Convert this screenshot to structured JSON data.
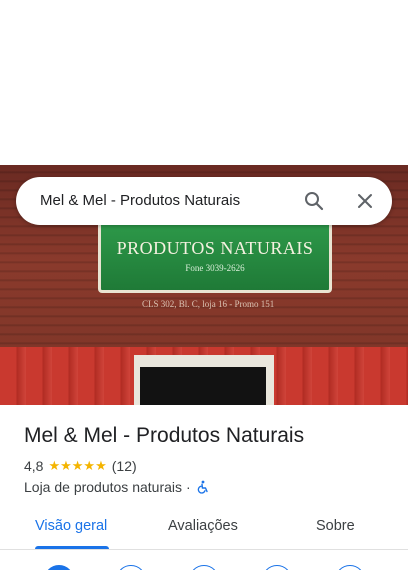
{
  "search": {
    "query": "Mel & Mel - Produtos Naturais",
    "search_icon": "search-icon",
    "close_icon": "close-icon"
  },
  "photo": {
    "sign_main": "PRODUTOS NATURAIS",
    "sign_sub": "Fone 3039-2626",
    "address": "CLS 302, Bl. C, loja 16 - Promo 151"
  },
  "place": {
    "name": "Mel & Mel - Produtos Naturais",
    "rating": "4,8",
    "stars": "★★★★★",
    "review_count": "(12)",
    "category": "Loja de produtos naturais",
    "separator": "·",
    "accessibility_icon": "wheelchair-icon"
  },
  "tabs": [
    {
      "label": "Visão geral",
      "active": true
    },
    {
      "label": "Avaliações",
      "active": false
    },
    {
      "label": "Sobre",
      "active": false
    }
  ],
  "colors": {
    "accent": "#1a73e8",
    "star": "#f4b400"
  }
}
